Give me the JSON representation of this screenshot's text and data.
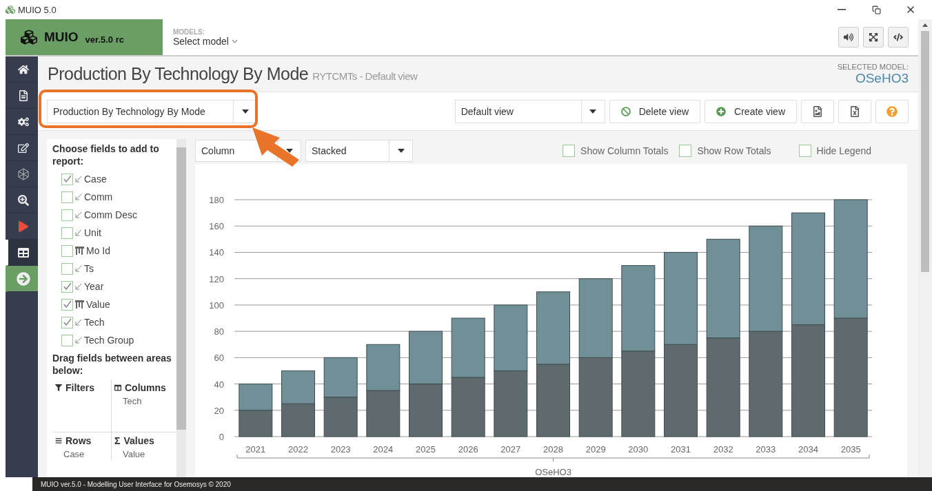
{
  "window": {
    "title": "MUIO 5.0"
  },
  "brand": {
    "name": "MUIO",
    "version": "ver.5.0 rc"
  },
  "models": {
    "label": "MODELS:",
    "value": "Select model"
  },
  "nav": [
    {
      "selected": false
    },
    {
      "selected": false
    },
    {
      "selected": false
    },
    {
      "selected": false
    },
    {
      "selected": false
    },
    {
      "selected": false
    },
    {
      "selected": false
    },
    {
      "selected": true
    },
    {
      "selected": false,
      "kind": "action"
    }
  ],
  "page": {
    "title": "Production By Technology By Mode",
    "subtitle": "RYTCMTs - Default view",
    "selected_model_label": "SELECTED MODEL:",
    "selected_model": "OSeHO3"
  },
  "report_select": {
    "value": "Production By Technology By Mode",
    "highlighted": true
  },
  "view_select": {
    "value": "Default view"
  },
  "buttons": [
    "Delete view",
    "Create view"
  ],
  "chart_type": {
    "value": "Column"
  },
  "chart_mode": {
    "value": "Stacked"
  },
  "options": [
    {
      "label": "Show Column Totals",
      "checked": false
    },
    {
      "label": "Show Row Totals",
      "checked": false
    },
    {
      "label": "Hide Legend",
      "checked": false
    }
  ],
  "fields_heading": "Choose fields to add to report:",
  "fields": [
    {
      "label": "Case",
      "kind": "dimension",
      "checked": true
    },
    {
      "label": "Comm",
      "kind": "dimension",
      "checked": false
    },
    {
      "label": "Comm Desc",
      "kind": "dimension",
      "checked": false
    },
    {
      "label": "Unit",
      "kind": "dimension",
      "checked": false
    },
    {
      "label": "Mo Id",
      "kind": "measure",
      "checked": false
    },
    {
      "label": "Ts",
      "kind": "dimension",
      "checked": false
    },
    {
      "label": "Year",
      "kind": "dimension",
      "checked": true
    },
    {
      "label": "Value",
      "kind": "measure",
      "checked": true
    },
    {
      "label": "Tech",
      "kind": "dimension",
      "checked": true
    },
    {
      "label": "Tech Group",
      "kind": "dimension",
      "checked": false
    }
  ],
  "areas_heading": "Drag fields between areas below:",
  "areas": [
    {
      "kind": "filters",
      "label": "Filters"
    },
    {
      "kind": "columns",
      "label": "Columns",
      "items": [
        "Tech"
      ]
    },
    {
      "kind": "rows",
      "label": "Rows",
      "items": [
        "Case"
      ]
    },
    {
      "kind": "values",
      "symbol": "Σ",
      "label": "Values",
      "items": [
        "Value"
      ]
    }
  ],
  "chart": {
    "chart_data": {
      "type": "bar",
      "stacked": true,
      "grid": true,
      "categories": [
        "2021",
        "2022",
        "2023",
        "2024",
        "2025",
        "2026",
        "2027",
        "2028",
        "2029",
        "2030",
        "2031",
        "2032",
        "2033",
        "2034",
        "2035"
      ],
      "xlabel": "OSeHO3",
      "ylim": [
        0,
        180
      ],
      "yticks": [
        0,
        20,
        40,
        60,
        80,
        100,
        120,
        140,
        160,
        180
      ],
      "series": [
        {
          "color": "#5e6a6e",
          "values": [
            20,
            25,
            30,
            35,
            40,
            45,
            50,
            55,
            60,
            65,
            70,
            75,
            80,
            85,
            90
          ]
        },
        {
          "color": "#6f9096",
          "values": [
            20,
            25,
            30,
            35,
            40,
            45,
            50,
            55,
            60,
            65,
            70,
            75,
            80,
            85,
            90
          ]
        }
      ]
    }
  },
  "footer": "MUIO ver.5.0 - Modelling User Interface for Osemosys © 2020"
}
